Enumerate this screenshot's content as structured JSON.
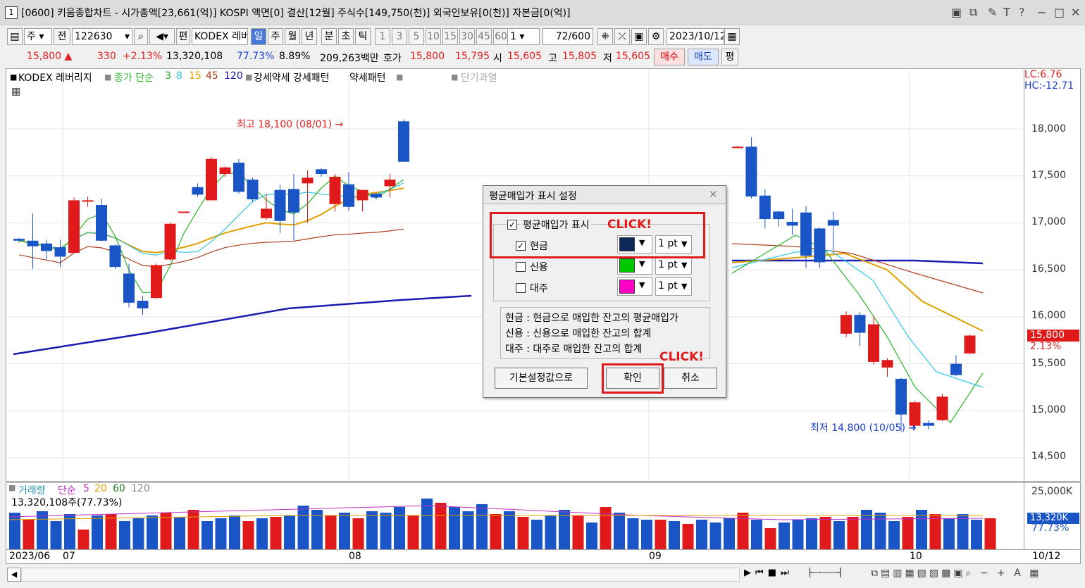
{
  "window": {
    "num": "1",
    "title": "[0600] 키움종합차트 - 시가총액[23,661(억)] KOSPI 액면[0] 결산[12월] 주식수[149,750(천)] 외국인보유[0(천)] 자본금[0(억)]"
  },
  "toolbar": {
    "market": "주",
    "type": "전",
    "code": "122630",
    "name_prefix": "편",
    "name": "KODEX 레버",
    "periods": [
      "일",
      "주",
      "월",
      "년",
      "분",
      "초",
      "틱"
    ],
    "ticks": [
      "1",
      "3",
      "5",
      "10",
      "15",
      "30",
      "45",
      "60"
    ],
    "multi": "1",
    "count": "72",
    "count_total": "/600",
    "date": "2023/10/12"
  },
  "quote": {
    "price": "15,800",
    "arrow": "▲",
    "change": "330",
    "pct": "+2.13%",
    "volume": "13,320,108",
    "ratio": "77.73%",
    "ratio2": "8.89%",
    "amount": "209,263백만",
    "ask_label": "호가",
    "ask": "15,800",
    "bid": "15,795",
    "open_label": "시",
    "open": "15,605",
    "high_label": "고",
    "high": "15,805",
    "low_label": "저",
    "low": "15,605",
    "buy": "매수",
    "sell": "매도",
    "avg": "평"
  },
  "legend": {
    "name": "KODEX 레버리지",
    "ma_label": "종가 단순",
    "ma3": "3",
    "ma8": "8",
    "ma15": "15",
    "ma45": "45",
    "ma120": "120",
    "strength": "강세약세 강세패턴",
    "weak": "약세패턴",
    "short": "단기과열"
  },
  "axis": {
    "lc": "LC:6.76",
    "hc": "HC:-12.71",
    "prices": [
      "18,000",
      "17,500",
      "17,000",
      "16,500",
      "16,000",
      "15,500",
      "15,000",
      "14,500"
    ],
    "current": "15,800",
    "current_pct": "2.13%"
  },
  "annotations": {
    "high": "최고 18,100 (08/01)",
    "low": "최저 14,800 (10/05)"
  },
  "volume": {
    "label": "거래량",
    "ma_label": "단순",
    "ma5": "5",
    "ma20": "20",
    "ma60": "60",
    "ma120": "120",
    "value": "13,320,108주(77.73%)",
    "axis_top": "25,000K",
    "axis_cur": "13,320K",
    "axis_pct": "77.73%"
  },
  "xaxis": {
    "labels": [
      "2023/06",
      "07",
      "08",
      "09",
      "10"
    ],
    "end": "10/12"
  },
  "dialog": {
    "title": "평균매입가 표시 설정",
    "show_label": "평균매입가 표시",
    "rows": [
      {
        "label": "현금",
        "checked": true,
        "color": "#0e2a5a",
        "width": "1 pt"
      },
      {
        "label": "신용",
        "checked": false,
        "color": "#00c800",
        "width": "1 pt"
      },
      {
        "label": "대주",
        "checked": false,
        "color": "#ff00c8",
        "width": "1 pt"
      }
    ],
    "desc": [
      "현금 : 현금으로 매입한 잔고의 평균매입가",
      "신용 : 신용으로 매입한 잔고의 합계",
      "대주 : 대주로 매입한 잔고의 합계"
    ],
    "default_btn": "기본설정값으로",
    "ok_btn": "확인",
    "cancel_btn": "취소",
    "click1": "CLICK!",
    "click2": "CLICK!"
  },
  "chart_data": {
    "type": "candlestick",
    "candles": [
      [
        16830,
        16810,
        16790,
        16840
      ],
      [
        16810,
        16750,
        16510,
        17100
      ],
      [
        16780,
        16700,
        16600,
        16820
      ],
      [
        16740,
        16640,
        16530,
        16820
      ],
      [
        16680,
        17240,
        16680,
        17270
      ],
      [
        17240,
        17240,
        17170,
        17280
      ],
      [
        17190,
        16810,
        16800,
        17260
      ],
      [
        16760,
        16530,
        16510,
        16770
      ],
      [
        16460,
        16150,
        16100,
        16560
      ],
      [
        16170,
        16090,
        16020,
        16220
      ],
      [
        16200,
        16550,
        16190,
        16570
      ],
      [
        16610,
        16990,
        16600,
        17000
      ],
      [
        17120,
        17120,
        17120,
        17120
      ],
      [
        17380,
        17300,
        17280,
        17420
      ],
      [
        17240,
        17680,
        17240,
        17700
      ],
      [
        17520,
        17590,
        17490,
        17600
      ],
      [
        17640,
        17330,
        17310,
        17680
      ],
      [
        17460,
        17250,
        17220,
        17480
      ],
      [
        17050,
        17150,
        17030,
        17300
      ],
      [
        17350,
        17020,
        16890,
        17400
      ],
      [
        17360,
        17110,
        16810,
        17520
      ],
      [
        17420,
        17480,
        17000,
        17560
      ],
      [
        17570,
        17520,
        17490,
        17580
      ],
      [
        17200,
        17490,
        17120,
        17520
      ],
      [
        17410,
        17170,
        17130,
        17540
      ],
      [
        17240,
        17350,
        17120,
        17330
      ],
      [
        17310,
        17270,
        17250,
        17320
      ],
      [
        17390,
        17460,
        17270,
        17520
      ],
      [
        18080,
        17650,
        17650,
        18100
      ],
      [
        17800,
        17810,
        17800,
        17820
      ],
      [
        17810,
        17280,
        17260,
        17910
      ],
      [
        17290,
        17040,
        16940,
        17360
      ],
      [
        17120,
        17040,
        16960,
        17130
      ],
      [
        17010,
        16970,
        16870,
        17150
      ],
      [
        17110,
        16650,
        16520,
        17180
      ],
      [
        16940,
        16580,
        16520,
        16950
      ],
      [
        17030,
        16970,
        16710,
        17120
      ]
    ],
    "price_axis": [
      "14,500",
      "18,000"
    ]
  }
}
